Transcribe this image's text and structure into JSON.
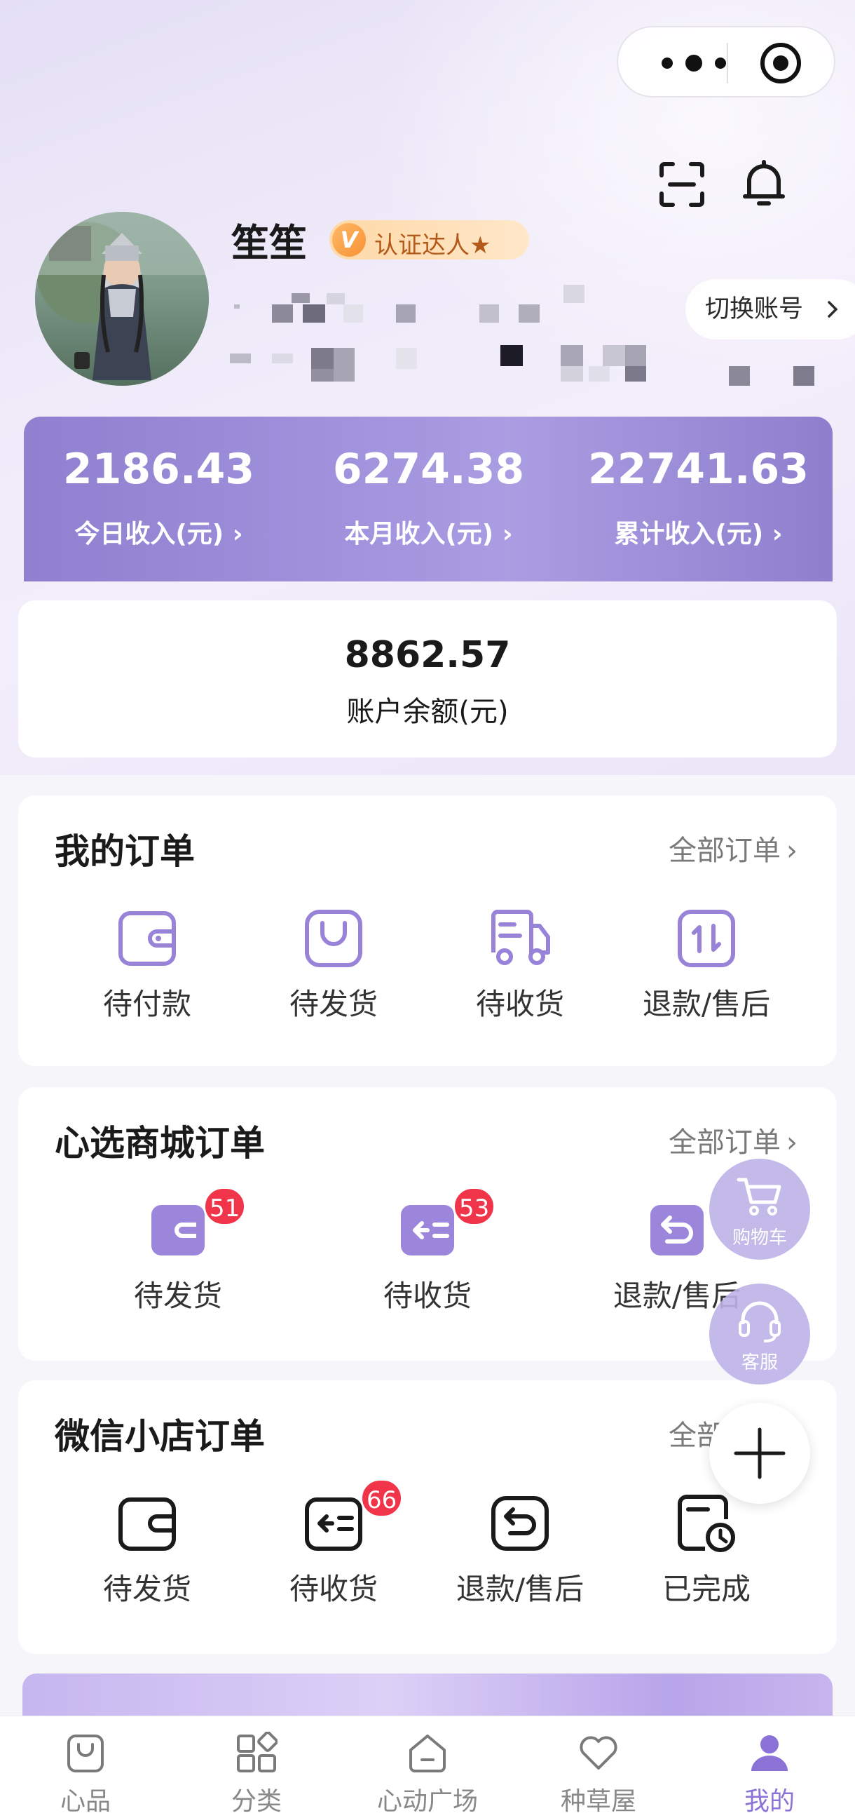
{
  "colors": {
    "accent": "#8a72d6",
    "badge_red": "#f0344a",
    "earnings_band": "#9f91db"
  },
  "capsule": {
    "more_icon": "more-dots-icon",
    "close_icon": "target-icon"
  },
  "header_icons": [
    "scan-icon",
    "bell-icon"
  ],
  "profile": {
    "name": "笙笙",
    "badge_letter": "V",
    "badge_text": "认证达人★",
    "switch_account": "切换账号"
  },
  "earnings": [
    {
      "value": "2186.43",
      "label": "今日收入(元)"
    },
    {
      "value": "6274.38",
      "label": "本月收入(元)"
    },
    {
      "value": "22741.63",
      "label": "累计收入(元)"
    }
  ],
  "balance": {
    "value": "8862.57",
    "label": "账户余额(元)"
  },
  "my_orders": {
    "title": "我的订单",
    "link": "全部订单",
    "items": [
      {
        "label": "待付款",
        "icon": "wallet-icon"
      },
      {
        "label": "待发货",
        "icon": "package-icon"
      },
      {
        "label": "待收货",
        "icon": "truck-icon"
      },
      {
        "label": "退款/售后",
        "icon": "refund-icon"
      }
    ]
  },
  "mall_orders": {
    "title": "心选商城订单",
    "link": "全部订单",
    "items": [
      {
        "label": "待发货",
        "badge": "51",
        "icon": "wallet-fill-icon"
      },
      {
        "label": "待收货",
        "badge": "53",
        "icon": "inbox-fill-icon"
      },
      {
        "label": "退款/售后",
        "icon": "return-fill-icon"
      }
    ]
  },
  "wechat_orders": {
    "title": "微信小店订单",
    "link": "全部订单",
    "items": [
      {
        "label": "待发货",
        "icon": "wallet-outline-icon"
      },
      {
        "label": "待收货",
        "badge": "66",
        "icon": "inbox-outline-icon"
      },
      {
        "label": "退款/售后",
        "icon": "return-outline-icon"
      },
      {
        "label": "已完成",
        "icon": "done-clock-icon"
      }
    ]
  },
  "floating": {
    "cart": "购物车",
    "service": "客服"
  },
  "tabs": [
    {
      "label": "心品",
      "icon": "bag-icon"
    },
    {
      "label": "分类",
      "icon": "grid-icon"
    },
    {
      "label": "心动广场",
      "icon": "plaza-icon"
    },
    {
      "label": "种草屋",
      "icon": "heart-icon"
    },
    {
      "label": "我的",
      "icon": "user-icon",
      "active": true
    }
  ]
}
